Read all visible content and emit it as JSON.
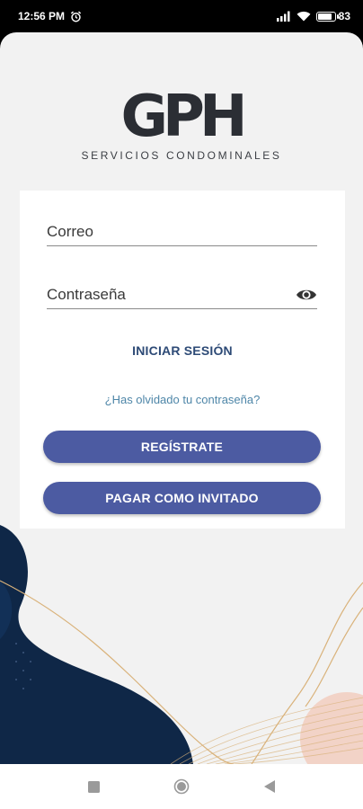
{
  "status_bar": {
    "time": "12:56 PM",
    "battery_text": "83",
    "battery_level": 0.83,
    "icons": [
      "alarm-icon",
      "signal-icon",
      "wifi-icon",
      "battery-icon"
    ]
  },
  "brand": {
    "logo_text": "GPH",
    "tagline": "SERVICIOS CONDOMINALES"
  },
  "login_form": {
    "email_placeholder": "Correo",
    "email_value": "",
    "password_placeholder": "Contraseña",
    "password_value": "",
    "login_label": "INICIAR SESIÓN",
    "forgot_label": "¿Has olvidado tu contraseña?",
    "register_label": "REGÍSTRATE",
    "guest_label": "PAGAR COMO INVITADO"
  },
  "nav_bar": {
    "buttons": [
      "recents-icon",
      "home-icon",
      "back-icon"
    ]
  },
  "colors": {
    "primary_button": "#4c5ba2",
    "link": "#2d4a76",
    "secondary_link": "#4e86a8",
    "navy_wave": "#0f2747",
    "gold_lines": "#d9b27a"
  }
}
